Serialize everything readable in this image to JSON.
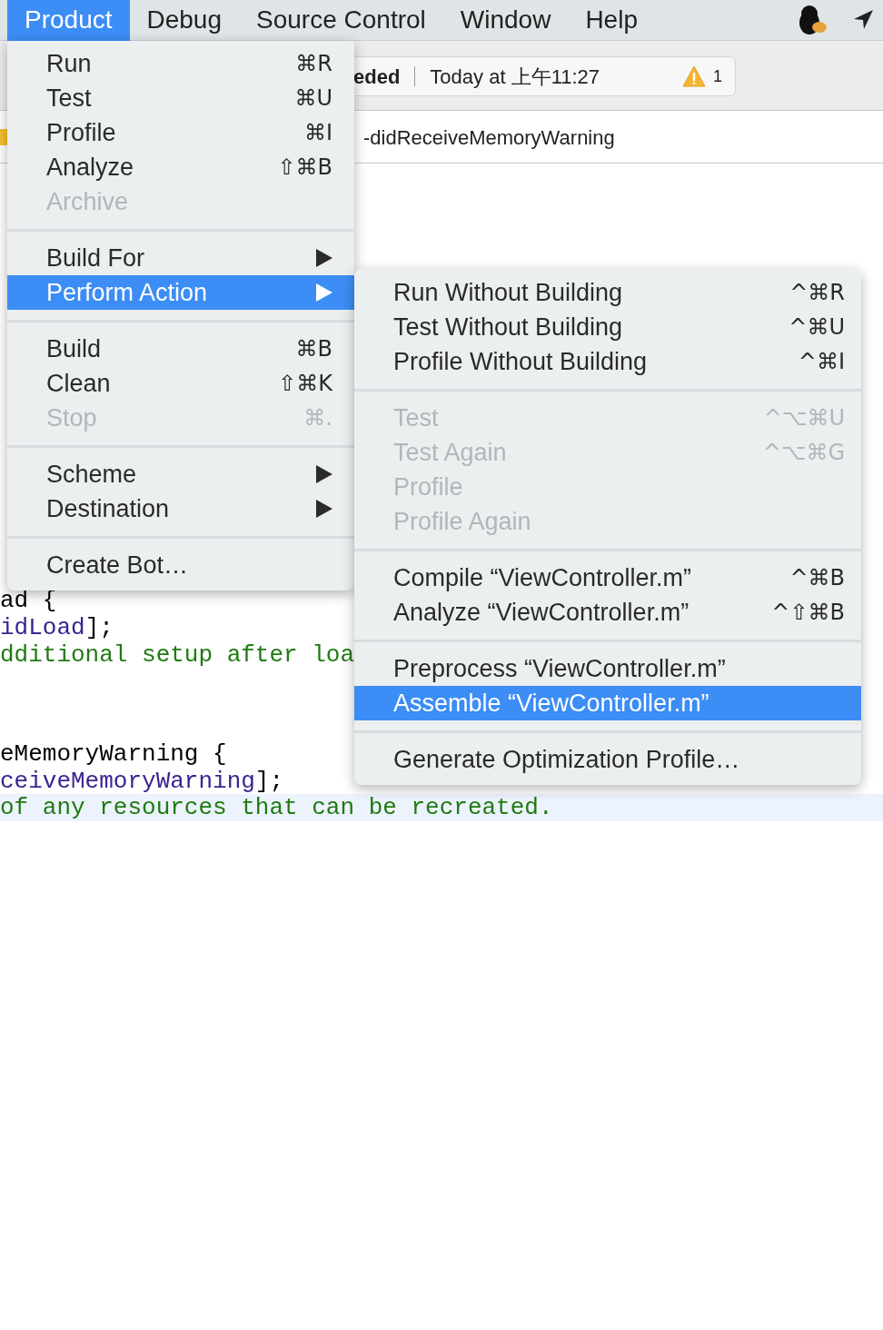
{
  "menubar": {
    "items": [
      {
        "label": "Product",
        "selected": true
      },
      {
        "label": "Debug",
        "selected": false
      },
      {
        "label": "Source Control",
        "selected": false
      },
      {
        "label": "Window",
        "selected": false
      },
      {
        "label": "Help",
        "selected": false
      }
    ]
  },
  "status": {
    "activity": "eded",
    "time": "Today at 上午11:27",
    "warning_count": "1"
  },
  "jump_bar": {
    "symbol": "-didReceiveMemoryWarning"
  },
  "code_lines": [
    {
      "highlighted": false,
      "tokens": [
        {
          "kind": "plain",
          "text": "ad {"
        }
      ]
    },
    {
      "highlighted": false,
      "tokens": [
        {
          "kind": "method",
          "text": "idLoad"
        },
        {
          "kind": "plain",
          "text": "];"
        }
      ]
    },
    {
      "highlighted": false,
      "tokens": [
        {
          "kind": "comment",
          "text": "dditional setup after loa"
        }
      ]
    },
    {
      "highlighted": false,
      "tokens": [
        {
          "kind": "plain",
          "text": "eMemoryWarning {"
        }
      ]
    },
    {
      "highlighted": false,
      "tokens": [
        {
          "kind": "method",
          "text": "ceiveMemoryWarning"
        },
        {
          "kind": "plain",
          "text": "];"
        }
      ]
    },
    {
      "highlighted": true,
      "tokens": [
        {
          "kind": "comment",
          "text": "of any resources that can be recreated."
        }
      ]
    }
  ],
  "product_menu": {
    "sections": [
      [
        {
          "label": "Run",
          "shortcut": "⌘R",
          "enabled": true,
          "submenu": false,
          "selected": false
        },
        {
          "label": "Test",
          "shortcut": "⌘U",
          "enabled": true,
          "submenu": false,
          "selected": false
        },
        {
          "label": "Profile",
          "shortcut": "⌘I",
          "enabled": true,
          "submenu": false,
          "selected": false
        },
        {
          "label": "Analyze",
          "shortcut": "⇧⌘B",
          "enabled": true,
          "submenu": false,
          "selected": false
        },
        {
          "label": "Archive",
          "enabled": false,
          "submenu": false,
          "selected": false
        }
      ],
      [
        {
          "label": "Build For",
          "enabled": true,
          "submenu": true,
          "selected": false
        },
        {
          "label": "Perform Action",
          "enabled": true,
          "submenu": true,
          "selected": true
        }
      ],
      [
        {
          "label": "Build",
          "shortcut": "⌘B",
          "enabled": true,
          "submenu": false,
          "selected": false
        },
        {
          "label": "Clean",
          "shortcut": "⇧⌘K",
          "enabled": true,
          "submenu": false,
          "selected": false
        },
        {
          "label": "Stop",
          "shortcut": "⌘.",
          "enabled": false,
          "submenu": false,
          "selected": false
        }
      ],
      [
        {
          "label": "Scheme",
          "enabled": true,
          "submenu": true,
          "selected": false
        },
        {
          "label": "Destination",
          "enabled": true,
          "submenu": true,
          "selected": false
        }
      ],
      [
        {
          "label": "Create Bot…",
          "enabled": true,
          "submenu": false,
          "selected": false
        }
      ]
    ]
  },
  "perform_action_submenu": {
    "sections": [
      [
        {
          "label": "Run Without Building",
          "shortcut": "^⌘R",
          "enabled": true,
          "selected": false
        },
        {
          "label": "Test Without Building",
          "shortcut": "^⌘U",
          "enabled": true,
          "selected": false
        },
        {
          "label": "Profile Without Building",
          "shortcut": "^⌘I",
          "enabled": true,
          "selected": false
        }
      ],
      [
        {
          "label": "Test",
          "shortcut": "^⌥⌘U",
          "enabled": false,
          "selected": false
        },
        {
          "label": "Test Again",
          "shortcut": "^⌥⌘G",
          "enabled": false,
          "selected": false
        },
        {
          "label": "Profile",
          "enabled": false,
          "selected": false
        },
        {
          "label": "Profile Again",
          "enabled": false,
          "selected": false
        }
      ],
      [
        {
          "label": "Compile “ViewController.m”",
          "shortcut": "^⌘B",
          "enabled": true,
          "selected": false
        },
        {
          "label": "Analyze “ViewController.m”",
          "shortcut": "^⇧⌘B",
          "enabled": true,
          "selected": false
        }
      ],
      [
        {
          "label": "Preprocess “ViewController.m”",
          "enabled": true,
          "selected": false
        },
        {
          "label": "Assemble “ViewController.m”",
          "enabled": true,
          "selected": true
        }
      ],
      [
        {
          "label": "Generate Optimization Profile…",
          "enabled": true,
          "selected": false
        }
      ]
    ]
  }
}
